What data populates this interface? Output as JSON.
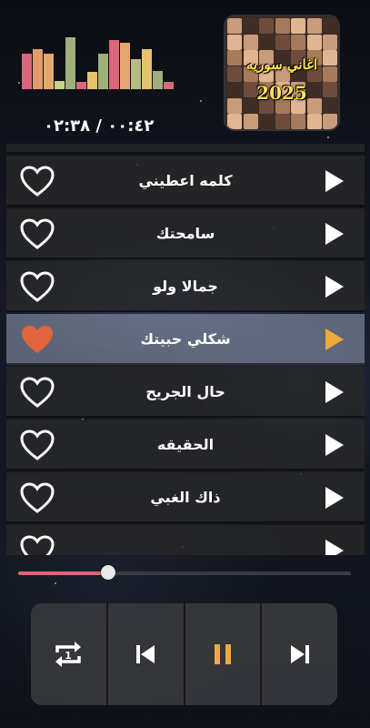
{
  "header": {
    "time_display": "٠٠:٤٢ / ٠٢:٣٨",
    "equalizer_levels": [
      0.67,
      0.76,
      0.67,
      0.16,
      0.98,
      0.14,
      0.33,
      0.67,
      0.93,
      0.88,
      0.57,
      0.76,
      0.34,
      0.14
    ],
    "equalizer_colors": [
      "#d9687a",
      "#e39a6a",
      "#e4a86f",
      "#c2d48a",
      "#9fb07a",
      "#d9687a",
      "#e6c46d",
      "#9fb07a",
      "#d9687a",
      "#e4a86f",
      "#b6bb84",
      "#e6c46d",
      "#9fb07a",
      "#d9687a"
    ],
    "album_cover": {
      "title": "اغاني سوريه",
      "year": "2025"
    }
  },
  "playlist": {
    "items": [
      {
        "title": "",
        "favorite": false,
        "active": false
      },
      {
        "title": "كلمه اعطيني",
        "favorite": false,
        "active": false
      },
      {
        "title": "سامحتك",
        "favorite": false,
        "active": false
      },
      {
        "title": "جمالا ولو",
        "favorite": false,
        "active": false
      },
      {
        "title": "شكلي حبيتك",
        "favorite": true,
        "active": true
      },
      {
        "title": "حال الجريح",
        "favorite": false,
        "active": false
      },
      {
        "title": "الحقيقه",
        "favorite": false,
        "active": false
      },
      {
        "title": "ذاك الغبي",
        "favorite": false,
        "active": false
      },
      {
        "title": "",
        "favorite": false,
        "active": false
      }
    ]
  },
  "progress": {
    "fraction": 0.27
  },
  "controls": {
    "repeat_badge": "1",
    "items": [
      "repeat-one",
      "previous",
      "pause",
      "next"
    ]
  },
  "colors": {
    "heart_active": "#e0643c",
    "play_active": "#f0a83c",
    "pause": "#f0a83c",
    "progress_fill": "#d9687a"
  }
}
